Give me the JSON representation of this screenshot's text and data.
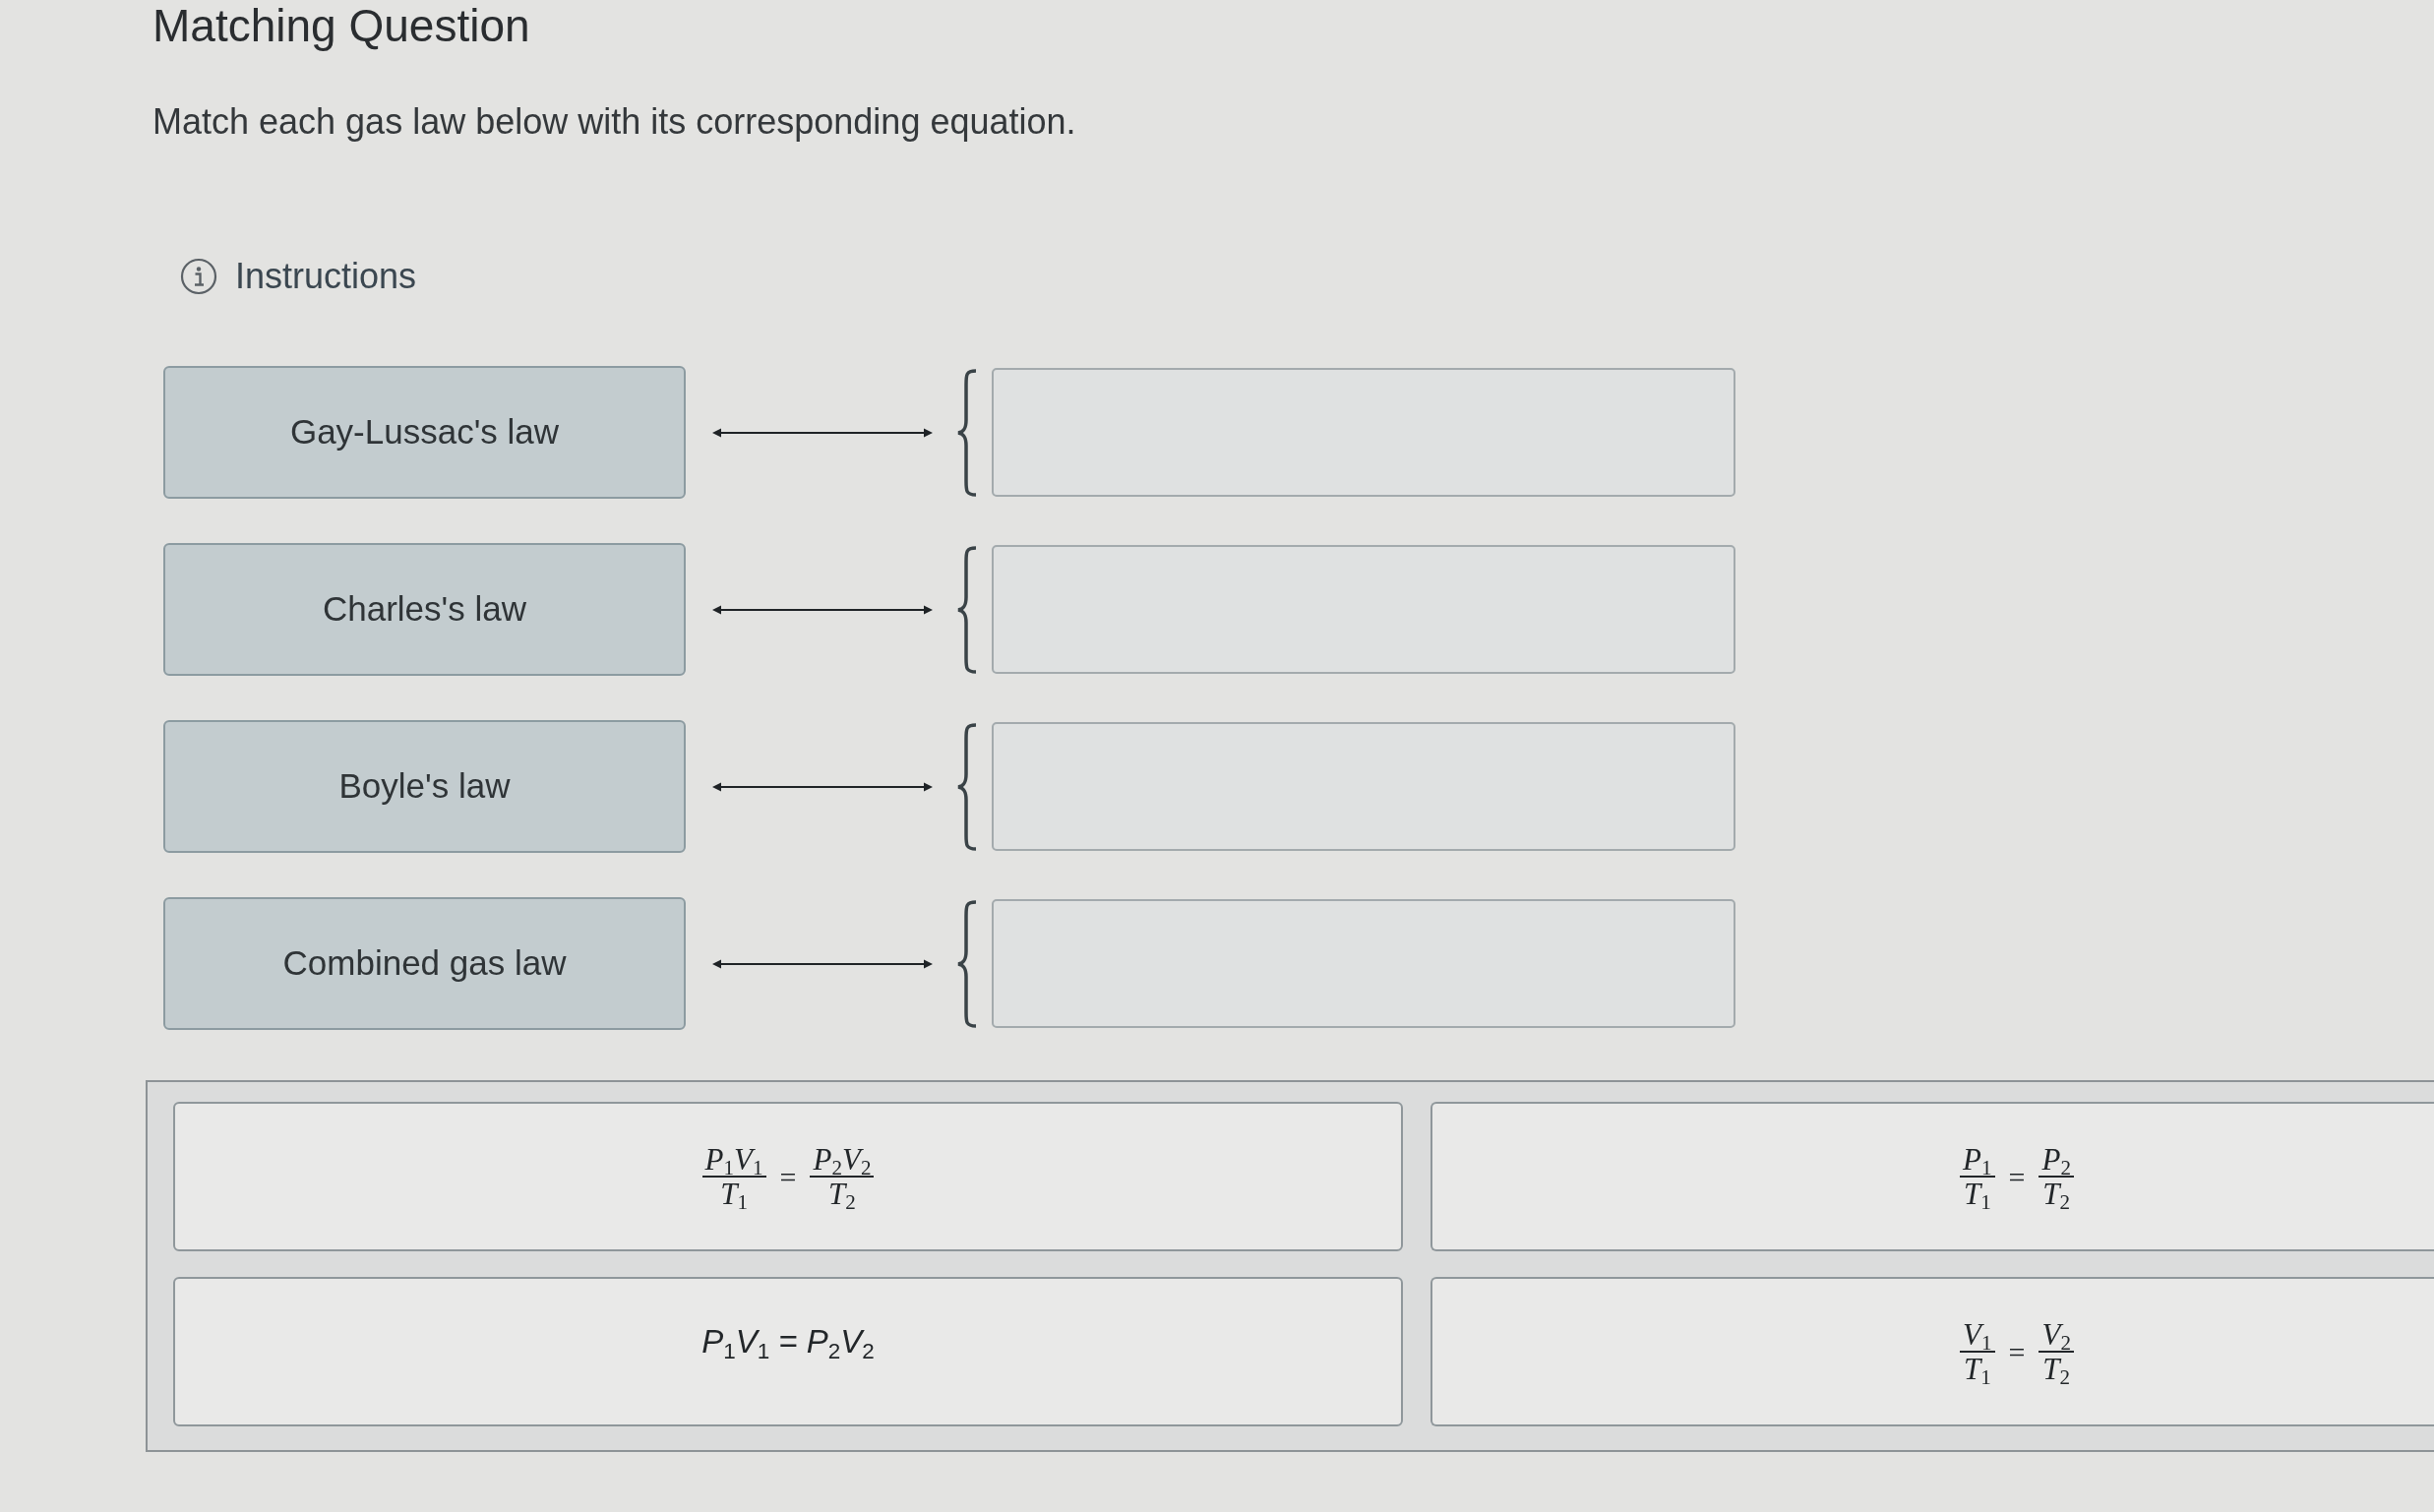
{
  "title": "Matching Question",
  "prompt": "Match each gas law below with its corresponding equation.",
  "instructions": {
    "label": "Instructions"
  },
  "rows": [
    {
      "term": "Gay-Lussac's law"
    },
    {
      "term": "Charles's law"
    },
    {
      "term": "Boyle's law"
    },
    {
      "term": "Combined gas law"
    }
  ],
  "choices": [
    {
      "kind": "fraction",
      "left": {
        "numerator": "P$_{1}$V$_{1}$",
        "denominator": "T$_{1}$"
      },
      "relation": "=",
      "right": {
        "numerator": "P$_{2}$V$_{2}$",
        "denominator": "T$_{2}$"
      }
    },
    {
      "kind": "fraction",
      "left": {
        "numerator": "P$_{1}$",
        "denominator": "T$_{1}$"
      },
      "relation": "=",
      "right": {
        "numerator": "P$_{2}$",
        "denominator": "T$_{2}$"
      }
    },
    {
      "kind": "inline",
      "text": "P$_{1}$V$_{1}$ = P$_{2}$V$_{2}$"
    },
    {
      "kind": "fraction",
      "left": {
        "numerator": "V$_{1}$",
        "denominator": "T$_{1}$"
      },
      "relation": "=",
      "right": {
        "numerator": "V$_{2}$",
        "denominator": "T$_{2}$"
      }
    }
  ]
}
